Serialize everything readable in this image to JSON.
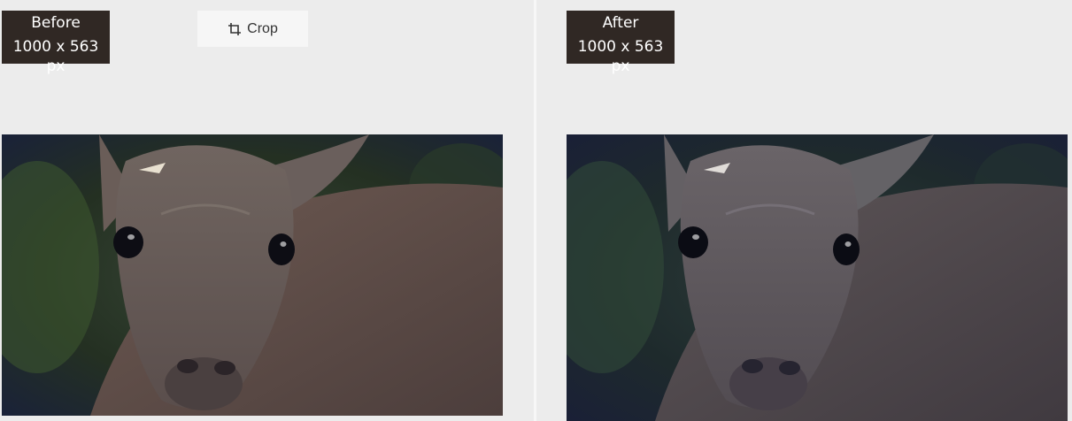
{
  "before": {
    "title": "Before",
    "dimensions": "1000 x 563 px",
    "image_subject": "deer-photo"
  },
  "after": {
    "title": "After",
    "dimensions": "1000 x 563 px",
    "image_subject": "deer-photo"
  },
  "toolbar": {
    "crop_label": "Crop",
    "crop_icon": "crop-icon"
  },
  "colors": {
    "background": "#ececec",
    "badge_bg": "#302824",
    "badge_text": "#ffffff",
    "button_bg": "#f6f6f6"
  }
}
